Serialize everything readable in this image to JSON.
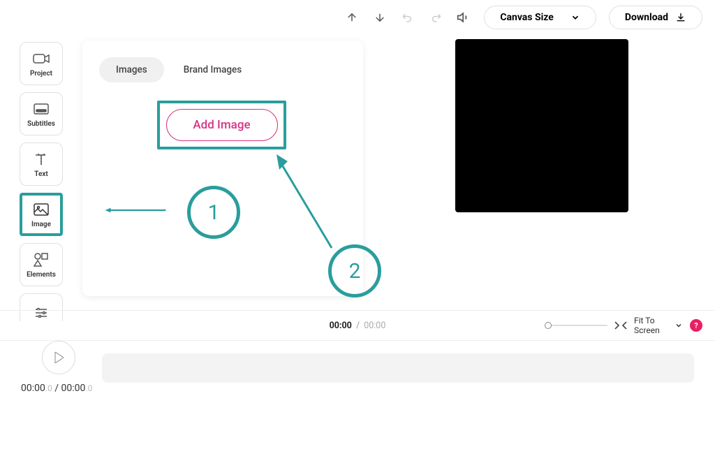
{
  "toolbar": {
    "canvas_size_label": "Canvas Size",
    "download_label": "Download"
  },
  "sidebar": {
    "items": [
      {
        "label": "Project"
      },
      {
        "label": "Subtitles"
      },
      {
        "label": "Text"
      },
      {
        "label": "Image"
      },
      {
        "label": "Elements"
      },
      {
        "label": ""
      }
    ]
  },
  "panel": {
    "tabs": [
      {
        "label": "Images"
      },
      {
        "label": "Brand Images"
      }
    ],
    "add_image_label": "Add Image"
  },
  "annotations": {
    "circle1": "1",
    "circle2": "2"
  },
  "time": {
    "current": "00:00",
    "total": "00:00",
    "sep": "/"
  },
  "bottom": {
    "fit_label": "Fit To Screen",
    "help": "?"
  },
  "timeline": {
    "current": "00:00",
    "current_frac": ".0",
    "sep": " / ",
    "total": "00:00",
    "total_frac": ".0"
  }
}
